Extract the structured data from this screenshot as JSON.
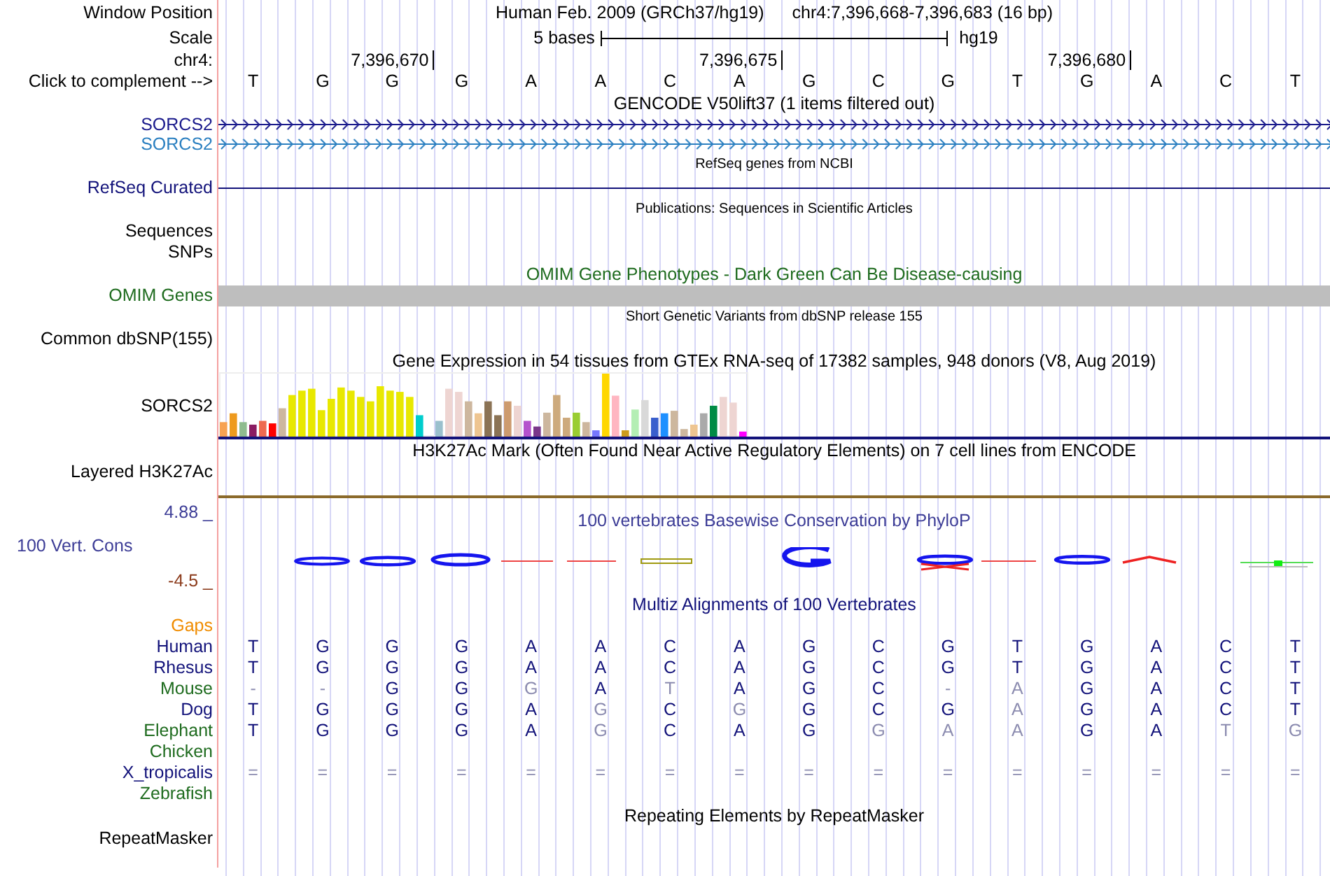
{
  "window_position": {
    "label": "Window Position",
    "assembly": "Human Feb. 2009 (GRCh37/hg19)",
    "range": "chr4:7,396,668-7,396,683 (16 bp)"
  },
  "scale": {
    "label": "Scale",
    "span": "5 bases",
    "assembly": "hg19"
  },
  "ruler": {
    "label": "chr4:",
    "ticks": [
      {
        "label": "7,396,670"
      },
      {
        "label": "7,396,675"
      },
      {
        "label": "7,396,680"
      }
    ]
  },
  "sequence": {
    "label": "Click to complement -->",
    "bases": [
      "T",
      "G",
      "G",
      "G",
      "A",
      "A",
      "C",
      "A",
      "G",
      "C",
      "G",
      "T",
      "G",
      "A",
      "C",
      "T"
    ]
  },
  "tracks": [
    {
      "kind": "title",
      "text": "GENCODE V50lift37 (1 items filtered out)"
    },
    {
      "kind": "gene",
      "label": "SORCS2",
      "color": "#1a1a8c"
    },
    {
      "kind": "gene",
      "label": "SORCS2",
      "color": "#2a7fc0"
    },
    {
      "kind": "subtitle",
      "text": "RefSeq genes from NCBI"
    },
    {
      "kind": "line",
      "label": "RefSeq Curated",
      "color": "#12127a"
    },
    {
      "kind": "subtitle",
      "text": "Publications: Sequences in Scientific Articles"
    },
    {
      "kind": "empty",
      "label": "Sequences"
    },
    {
      "kind": "empty",
      "label": "SNPs"
    },
    {
      "kind": "title",
      "text": "OMIM Gene Phenotypes - Dark Green Can Be Disease-causing",
      "color": "#1e6b1e"
    },
    {
      "kind": "bar",
      "label": "OMIM Genes",
      "color": "#1e6b1e"
    },
    {
      "kind": "subtitle",
      "text": "Short Genetic Variants from dbSNP release 155"
    },
    {
      "kind": "empty",
      "label": "Common dbSNP(155)"
    },
    {
      "kind": "title",
      "text": "Gene Expression in 54 tissues from GTEx RNA-seq of 17382 samples, 948 donors (V8, Aug 2019)"
    },
    {
      "kind": "expression",
      "label": "SORCS2"
    },
    {
      "kind": "title",
      "text": "H3K27Ac Mark (Often Found Near Active Regulatory Elements) on 7 cell lines from ENCODE"
    },
    {
      "kind": "flatline",
      "label": "Layered H3K27Ac"
    },
    {
      "kind": "conservation",
      "label": "100 Vert. Cons",
      "max": "4.88 _",
      "min": "-4.5 _",
      "title": "100 vertebrates Basewise Conservation by PhyloP",
      "color": "#3c3c96"
    },
    {
      "kind": "title",
      "text": "Multiz Alignments of 100 Vertebrates",
      "color": "#12127a"
    },
    {
      "kind": "alignment",
      "rows": [
        {
          "label": "Gaps",
          "color": "#f08c00"
        },
        {
          "label": "Human",
          "color": "#12127a",
          "bases": [
            "T",
            "G",
            "G",
            "G",
            "A",
            "A",
            "C",
            "A",
            "G",
            "C",
            "G",
            "T",
            "G",
            "A",
            "C",
            "T"
          ],
          "dimmed": [
            false,
            false,
            false,
            false,
            false,
            false,
            false,
            false,
            false,
            false,
            false,
            false,
            false,
            false,
            false,
            false
          ]
        },
        {
          "label": "Rhesus",
          "color": "#12127a",
          "bases": [
            "T",
            "G",
            "G",
            "G",
            "A",
            "A",
            "C",
            "A",
            "G",
            "C",
            "G",
            "T",
            "G",
            "A",
            "C",
            "T"
          ],
          "dimmed": [
            false,
            false,
            false,
            false,
            false,
            false,
            false,
            false,
            false,
            false,
            false,
            false,
            false,
            false,
            false,
            false
          ]
        },
        {
          "label": "Mouse",
          "color": "#1e6b1e",
          "bases": [
            "-",
            "-",
            "G",
            "G",
            "G",
            "A",
            "T",
            "A",
            "G",
            "C",
            "-",
            "A",
            "G",
            "A",
            "C",
            "T"
          ],
          "dimmed": [
            true,
            true,
            false,
            false,
            true,
            false,
            true,
            false,
            false,
            false,
            true,
            true,
            false,
            false,
            false,
            false
          ]
        },
        {
          "label": "Dog",
          "color": "#12127a",
          "bases": [
            "T",
            "G",
            "G",
            "G",
            "A",
            "G",
            "C",
            "G",
            "G",
            "C",
            "G",
            "A",
            "G",
            "A",
            "C",
            "T"
          ],
          "dimmed": [
            false,
            false,
            false,
            false,
            false,
            true,
            false,
            true,
            false,
            false,
            false,
            true,
            false,
            false,
            false,
            false
          ]
        },
        {
          "label": "Elephant",
          "color": "#1e6b1e",
          "bases": [
            "T",
            "G",
            "G",
            "G",
            "A",
            "G",
            "C",
            "A",
            "G",
            "G",
            "A",
            "A",
            "G",
            "A",
            "T",
            "G"
          ],
          "dimmed": [
            false,
            false,
            false,
            false,
            false,
            true,
            false,
            false,
            false,
            true,
            true,
            true,
            false,
            false,
            true,
            true
          ]
        },
        {
          "label": "Chicken",
          "color": "#1e6b1e"
        },
        {
          "label": "X_tropicalis",
          "color": "#12127a",
          "bases": [
            "=",
            "=",
            "=",
            "=",
            "=",
            "=",
            "=",
            "=",
            "=",
            "=",
            "=",
            "=",
            "=",
            "=",
            "=",
            "="
          ],
          "dimmed": [
            true,
            true,
            true,
            true,
            true,
            true,
            true,
            true,
            true,
            true,
            true,
            true,
            true,
            true,
            true,
            true
          ]
        },
        {
          "label": "Zebrafish",
          "color": "#1e6b1e"
        }
      ]
    },
    {
      "kind": "title",
      "text": "Repeating Elements by RepeatMasker"
    },
    {
      "kind": "empty",
      "label": "RepeatMasker"
    }
  ]
}
